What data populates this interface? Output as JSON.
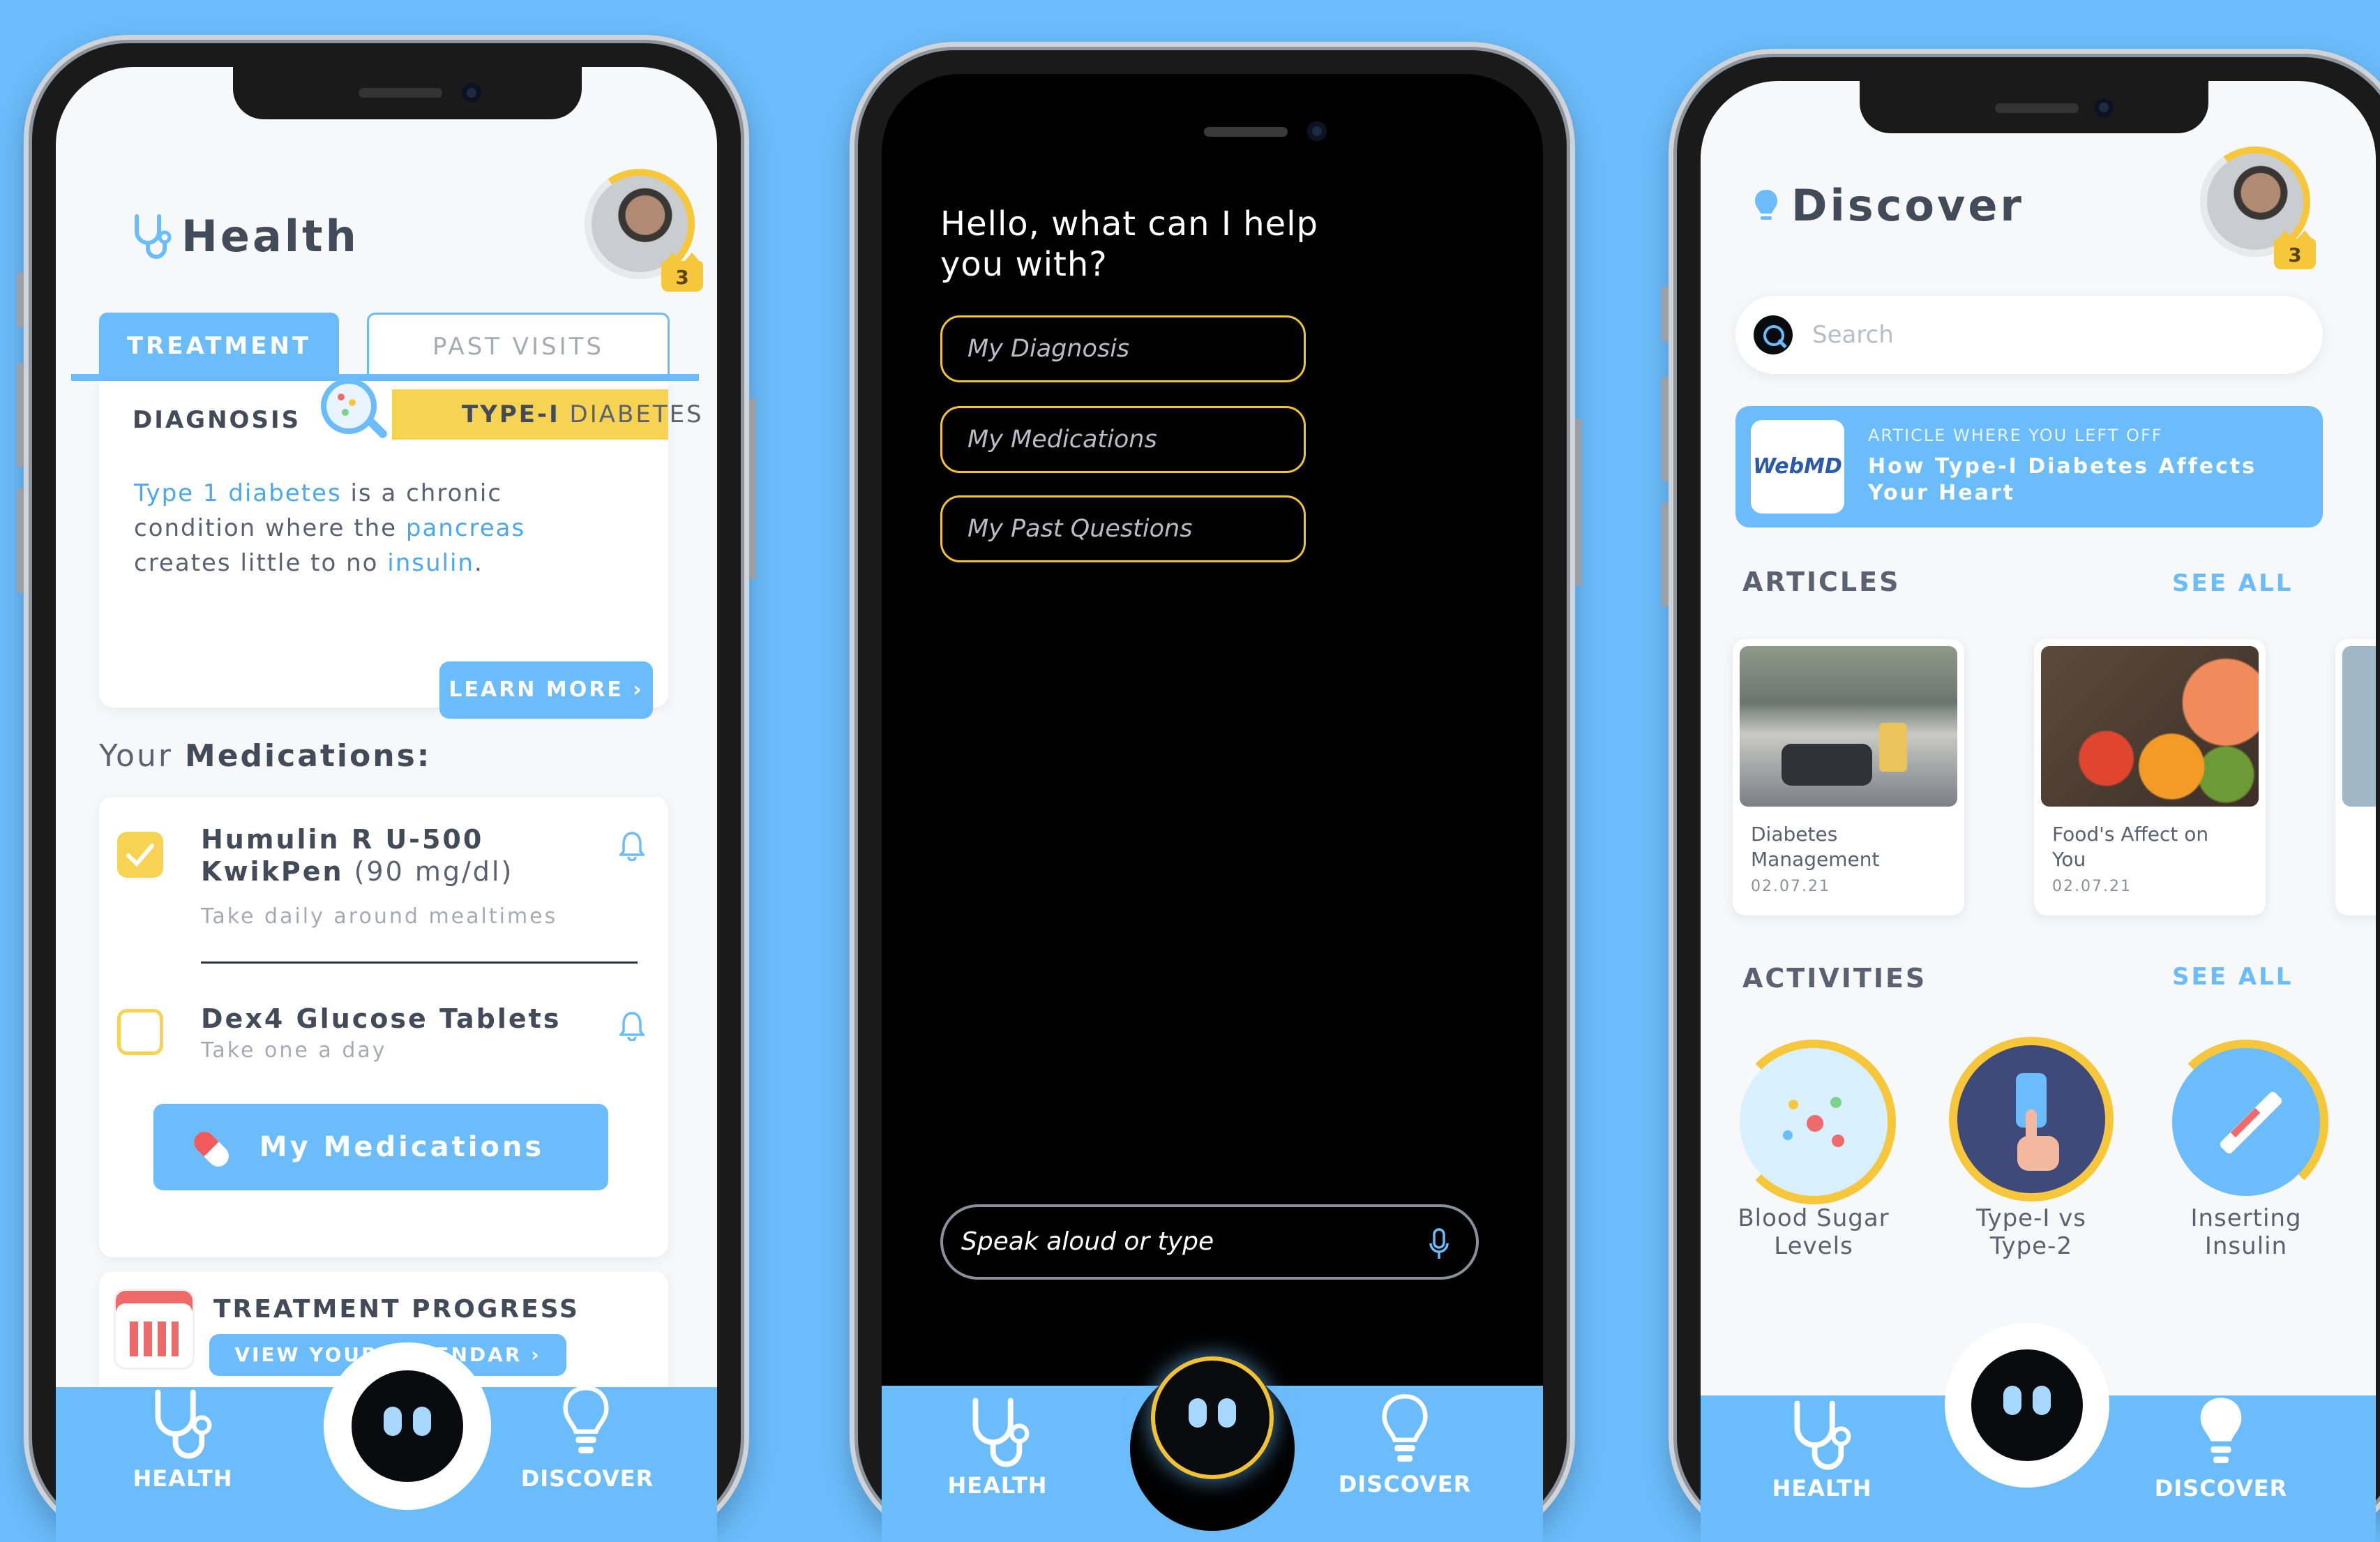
{
  "health": {
    "title": "Health",
    "level_badge": "3",
    "tabs": [
      "TREATMENT",
      "PAST VISITS"
    ],
    "diagnosis_label": "DIAGNOSIS",
    "diagnosis_value_bold": "TYPE-I",
    "diagnosis_value_rest": "DIABETES",
    "desc_link1": "Type 1 diabetes",
    "desc_text1": " is a chronic",
    "desc_text2": "condition where the ",
    "desc_link2": "pancreas",
    "desc_text3": "creates little to no ",
    "desc_link3": "insulin",
    "desc_text4": ".",
    "learn_more": "LEARN MORE ›",
    "medications_prefix": "Your ",
    "medications_bold": "Medications:",
    "meds": [
      {
        "name_line1": "Humulin R U-500",
        "name_line2": "KwikPen",
        "dose": " (90 mg/dl)",
        "instruction": "Take daily around mealtimes",
        "checked": true
      },
      {
        "name_line1": "Dex4 Glucose Tablets",
        "instruction": "Take one a day",
        "checked": false
      }
    ],
    "my_medications_button": "My Medications",
    "progress_title": "TREATMENT PROGRESS",
    "progress_button": "VIEW YOUR CALENDAR  ›"
  },
  "assistant": {
    "greeting_line1": "Hello, what can I help",
    "greeting_line2": "you with?",
    "chips": [
      "My Diagnosis",
      "My Medications",
      "My Past Questions"
    ],
    "input_placeholder": "Speak aloud or type"
  },
  "discover": {
    "title": "Discover",
    "level_badge": "3",
    "search_placeholder": "Search",
    "resume_source": "WebMD",
    "resume_kicker": "ARTICLE WHERE YOU LEFT OFF",
    "resume_title_line1": "How Type-I Diabetes Affects",
    "resume_title_line2": "Your Heart",
    "articles_title": "ARTICLES",
    "activities_title": "ACTIVITIES",
    "see_all": "SEE ALL",
    "articles": [
      {
        "title": "Diabetes Management",
        "date": "02.07.21"
      },
      {
        "title": "Food's Affect on You",
        "date": "02.07.21"
      }
    ],
    "activities": [
      {
        "line1": "Blood Sugar",
        "line2": "Levels",
        "progress": 0.6
      },
      {
        "line1": "Type-I vs",
        "line2": "Type-2",
        "progress": 0.75
      },
      {
        "line1": "Inserting",
        "line2": "Insulin",
        "progress": 0.3
      }
    ]
  },
  "nav": {
    "health": "HEALTH",
    "discover": "DISCOVER"
  },
  "colors": {
    "accent": "#6bbcfb",
    "gold": "#f6c63b",
    "background": "#6bbcfb",
    "dark": "#000000"
  }
}
